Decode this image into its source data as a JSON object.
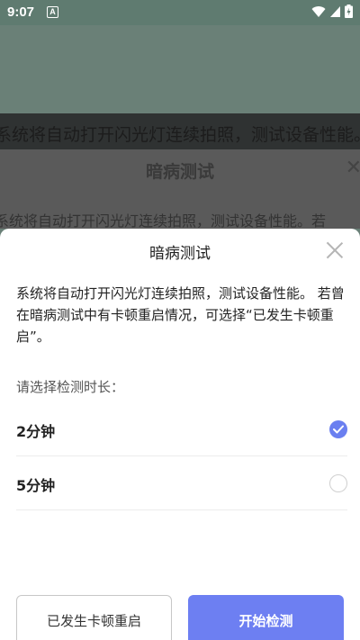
{
  "status_bar": {
    "time": "9:07",
    "notification": "A"
  },
  "background": {
    "band_text": "系统将自动打开闪光灯连续拍照，测试设备性能。若",
    "dialog_title": "暗病测试",
    "dialog_text": "系统将自动打开闪光灯连续拍照，测试设备性能。若"
  },
  "sheet": {
    "title": "暗病测试",
    "description": "系统将自动打开闪光灯连续拍照，测试设备性能。 若曾在暗病测试中有卡顿重启情况，可选择“已发生卡顿重启”。",
    "prompt": "请选择检测时长：",
    "options": [
      {
        "label": "2分钟",
        "selected": true
      },
      {
        "label": "5分钟",
        "selected": false
      }
    ],
    "secondary_button": "已发生卡顿重启",
    "primary_button": "开始检测"
  },
  "colors": {
    "accent": "#6d7ff2",
    "status_bar": "#5f7b70"
  }
}
